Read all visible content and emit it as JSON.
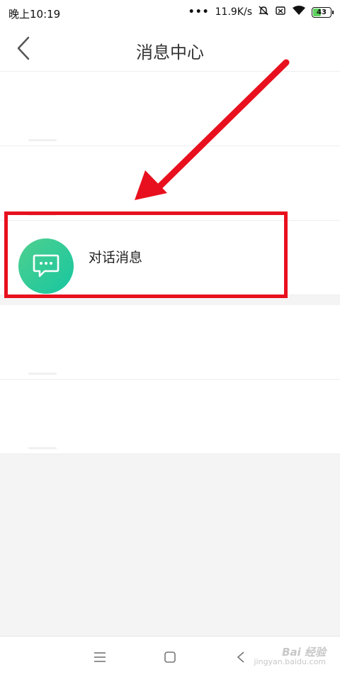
{
  "status_bar": {
    "time": "晚上10:19",
    "network_speed": "11.9K/s",
    "battery": "43",
    "icons": [
      "dots-icon",
      "mute-icon",
      "sim-off-icon",
      "wifi-icon",
      "battery-icon"
    ]
  },
  "header": {
    "title": "消息中心",
    "back_icon": "chevron-left-icon"
  },
  "list": {
    "rows": [
      {
        "label": ""
      },
      {
        "label": ""
      },
      {
        "label": "对话消息",
        "icon": "chat-bubble-icon"
      },
      {
        "label": ""
      },
      {
        "label": ""
      }
    ]
  },
  "annotation": {
    "color": "#e8101e"
  },
  "accent": {
    "icon_gradient_start": "#4fd08f",
    "icon_gradient_end": "#17c6a0"
  },
  "bottom_nav": {
    "buttons": [
      "menu-icon",
      "home-square-icon",
      "back-chevron-icon"
    ],
    "watermark_main": "Bai 经验",
    "watermark_sub": "jingyan.baidu.com"
  }
}
